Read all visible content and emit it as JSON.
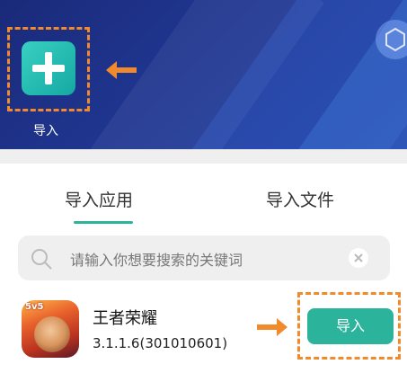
{
  "banner": {
    "import_label": "导入"
  },
  "tabs": [
    {
      "label": "导入应用",
      "active": true
    },
    {
      "label": "导入文件",
      "active": false
    }
  ],
  "search": {
    "placeholder": "请输入你想要搜索的关键词"
  },
  "apps": [
    {
      "name": "王者荣耀",
      "version": "3.1.1.6(301010601)",
      "badge": "5v5",
      "action_label": "导入"
    }
  ],
  "colors": {
    "accent": "#2bb39c",
    "highlight": "#f08a2c",
    "banner": "#1f3690"
  }
}
